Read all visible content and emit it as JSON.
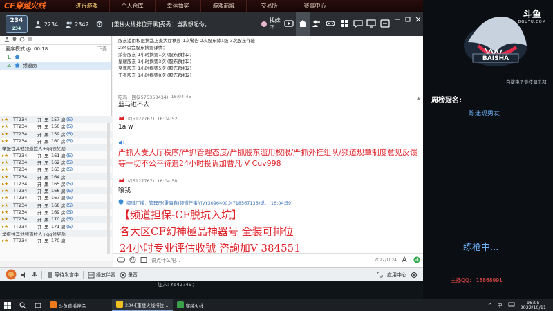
{
  "game_bar": {
    "logo": "CF穿越火线",
    "tabs": [
      "进行游戏",
      "个人仓库",
      "幸运抽奖",
      "游戏商城",
      "交易所",
      "赛事中心"
    ]
  },
  "toolbar": {
    "room_number": "234",
    "room_sub": "234",
    "online_count": "2234",
    "member_count": "2342",
    "room_title": "[重楼火线排位开黑]秀秀：当我想起你，",
    "find_label": "找妹子"
  },
  "left_panel": {
    "mode_label": "麦序模式",
    "mode_time": "00:18",
    "down_label": "下麦",
    "channels": [
      {
        "num": "1.",
        "name": ""
      },
      {
        "num": "2.",
        "name": "频道房"
      }
    ],
    "users": [
      {
        "name": "TT234",
        "open": "开",
        "black": "黑",
        "num": "157",
        "fang": "房",
        "count": "(5)"
      },
      {
        "name": "TT234",
        "open": "开",
        "black": "黑",
        "num": "150",
        "fang": "房",
        "count": "(5)"
      },
      {
        "name": "TT234",
        "open": "开",
        "black": "黑",
        "num": "159",
        "fang": "房",
        "count": "(5)"
      },
      {
        "name": "TT234",
        "open": "开",
        "black": "黑",
        "num": "160",
        "fang": "房",
        "count": "(5)"
      },
      {
        "promo": "举报往其他频道拉人+qq领奖励"
      },
      {
        "name": "TT234",
        "open": "开",
        "black": "黑",
        "num": "161",
        "fang": "房",
        "count": "(5)"
      },
      {
        "name": "TT234",
        "open": "开",
        "black": "黑",
        "num": "162",
        "fang": "房",
        "count": "(5)"
      },
      {
        "name": "TT234",
        "open": "开",
        "black": "黑",
        "num": "163",
        "fang": "房",
        "count": "(5)"
      },
      {
        "name": "TT234",
        "open": "开",
        "black": "黑",
        "num": "164",
        "fang": "房",
        "count": ""
      },
      {
        "name": "TT234",
        "open": "开",
        "black": "黑",
        "num": "165",
        "fang": "房",
        "count": "(5)"
      },
      {
        "name": "TT234",
        "open": "开",
        "black": "黑",
        "num": "166",
        "fang": "房",
        "count": "(5)"
      },
      {
        "name": "TT234",
        "open": "开",
        "black": "黑",
        "num": "167",
        "fang": "房",
        "count": "(5)"
      },
      {
        "name": "TT234",
        "open": "开",
        "black": "黑",
        "num": "168",
        "fang": "房",
        "count": "(5)"
      },
      {
        "name": "TT234",
        "open": "开",
        "black": "黑",
        "num": "169",
        "fang": "房",
        "count": "(5)"
      },
      {
        "name": "TT234",
        "open": "开",
        "black": "黑",
        "num": "170",
        "fang": "房",
        "count": "(5)"
      },
      {
        "name": "TT234",
        "open": "开",
        "black": "黑",
        "num": "171",
        "fang": "房",
        "count": "(5)"
      },
      {
        "promo": "举报往其他频道拉人+qq领奖励"
      },
      {
        "name": "TT234",
        "open": "开",
        "black": "黑",
        "num": "170",
        "fang": "房",
        "count": ""
      }
    ]
  },
  "chat": {
    "announcement": [
      "股东滥用权限抗乱上麦大厅秩序 1次警告 2次股东降1级 3次股东作废",
      "234公会股东摘要详情：",
      "荣誉股东 1小时摘要1次 (股东群扣2)",
      "星耀股东 1小时摘要3次 (股东群扣2)",
      "至尊股东 1小时摘要5次 (股东群扣2)",
      "王者股东 1小时摘要8次 (股东群扣2)"
    ],
    "messages": [
      {
        "user": "吃鸡一回(2575353434)",
        "time": "16:04:45",
        "text": "蓝马进不去"
      },
      {
        "user": "K(5127767)",
        "time": "16:04:52",
        "text": "1a w"
      },
      {
        "user": "K(5127767)",
        "time": "16:04:58",
        "text": "喰我"
      }
    ],
    "red_notice": "严抓大麦大厅秩序/严抓管理态度/严抓股东滥用权限/严抓外挂组队/频道规章制度意见反馈等一切不公平待遇24小时投诉加曹凡 V Cuv998",
    "broadcast_meta": "频道广播：管理员(秉海鑫)频道任事加VY3096400.)(718567136)说：(16:04:59)",
    "ad_lines": [
      "【频道担保-CF脱坑入坑】",
      "各大区CF幻神極品神器号 全装可排位",
      "24小时专业评估收號 咨詢加V 384551"
    ]
  },
  "input": {
    "placeholder": "说点什么吧...",
    "count": "2022/1024"
  },
  "bottom_bar": {
    "queue_label": "等待发言中",
    "accompany_label": "播放伴奏",
    "record_label": "录音",
    "app_center": "应用中心"
  },
  "under_text": "加入: Y642749：",
  "stream": {
    "logo": "斗鱼",
    "logo_sub": "DOUYU.COM",
    "team_caption": "白鲨电子竞技俱乐部",
    "rank_label": "周榜冠名:",
    "rank_name": "陈迷现男友",
    "status": "练枪中...",
    "qq": "主播QQ： 18868991"
  },
  "taskbar": {
    "apps": [
      "斗鱼直播伴侣",
      "234-[重楼火线排位...",
      "穿越火线"
    ],
    "ime": "中",
    "time": "16:05",
    "date": "2022/10/11"
  },
  "colors": {
    "accent_red": "#e0242b",
    "link_blue": "#6fb6ff",
    "toolbar_dark": "#2b2f33"
  }
}
